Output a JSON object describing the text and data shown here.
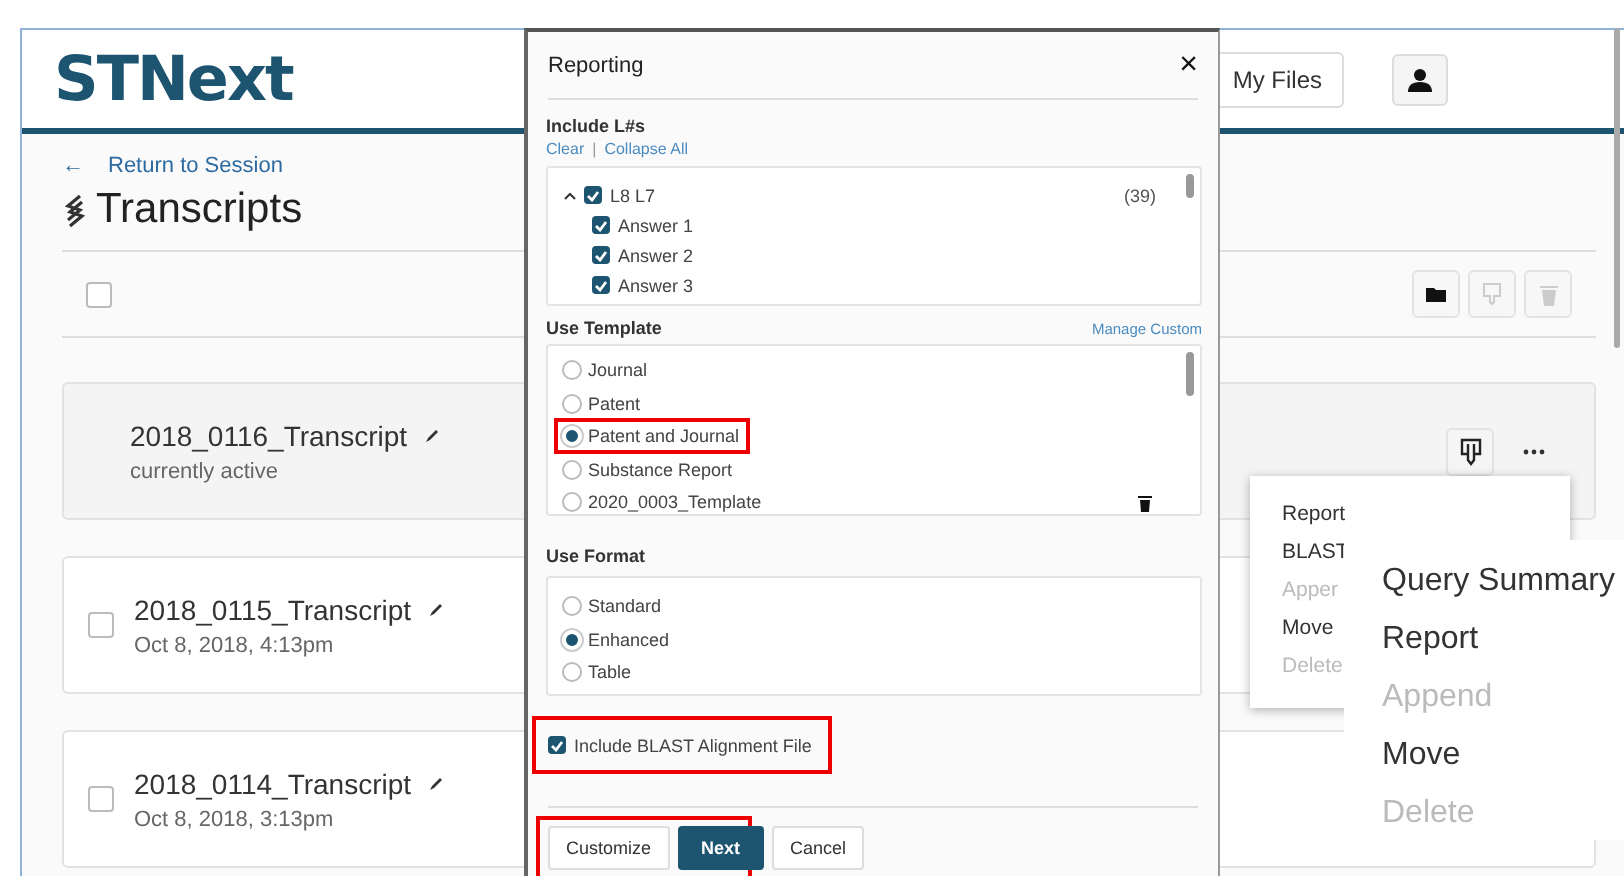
{
  "header": {
    "logo": "STNext",
    "my_files": "My Files"
  },
  "page": {
    "back_link": "Return to Session",
    "back_arrow": "←",
    "title": "Transcripts",
    "select_all_checked": false
  },
  "transcripts": [
    {
      "name": "2018_0116_Transcript",
      "subtitle": "currently active",
      "active": true
    },
    {
      "name": "2018_0115_Transcript",
      "subtitle": "Oct 8, 2018, 4:13pm",
      "active": false,
      "checked": false
    },
    {
      "name": "2018_0114_Transcript",
      "subtitle": "Oct 8, 2018, 3:13pm",
      "active": false,
      "checked": false
    }
  ],
  "row_menu": [
    {
      "label": "Report",
      "disabled": false
    },
    {
      "label": "BLAST",
      "disabled": false
    },
    {
      "label": "Apper",
      "disabled": true
    },
    {
      "label": "Move",
      "disabled": false
    },
    {
      "label": "Delete",
      "disabled": true
    }
  ],
  "zoomed_menu": [
    {
      "label": "Query Summary",
      "disabled": false
    },
    {
      "label": "Report",
      "disabled": false
    },
    {
      "label": "Append",
      "disabled": true
    },
    {
      "label": "Move",
      "disabled": false
    },
    {
      "label": "Delete",
      "disabled": true
    }
  ],
  "dialog": {
    "title": "Reporting",
    "close": "×",
    "include_label": "Include L#s",
    "clear": "Clear",
    "separator": "|",
    "collapse_all": "Collapse All",
    "tree": [
      {
        "label": "L8  L7",
        "count": "(39)",
        "checked": true,
        "expanded": true,
        "children": [
          {
            "label": "Answer 1",
            "checked": true
          },
          {
            "label": "Answer 2",
            "checked": true
          },
          {
            "label": "Answer 3",
            "checked": true
          }
        ]
      }
    ],
    "template_label": "Use Template",
    "manage_custom": "Manage Custom",
    "templates": [
      {
        "label": "Journal",
        "selected": false,
        "deletable": false
      },
      {
        "label": "Patent",
        "selected": false,
        "deletable": false
      },
      {
        "label": "Patent and Journal",
        "selected": true,
        "highlighted": true,
        "deletable": false
      },
      {
        "label": "Substance Report",
        "selected": false,
        "deletable": false
      },
      {
        "label": "2020_0003_Template",
        "selected": false,
        "deletable": true
      }
    ],
    "format_label": "Use Format",
    "formats": [
      {
        "label": "Standard",
        "selected": false
      },
      {
        "label": "Enhanced",
        "selected": true
      },
      {
        "label": "Table",
        "selected": false
      }
    ],
    "blast": {
      "label": "Include BLAST Alignment File",
      "checked": true,
      "highlighted": true
    },
    "buttons": [
      {
        "label": "Customize",
        "kind": "secondary"
      },
      {
        "label": "Next",
        "kind": "primary"
      },
      {
        "label": "Cancel",
        "kind": "secondary"
      }
    ]
  }
}
